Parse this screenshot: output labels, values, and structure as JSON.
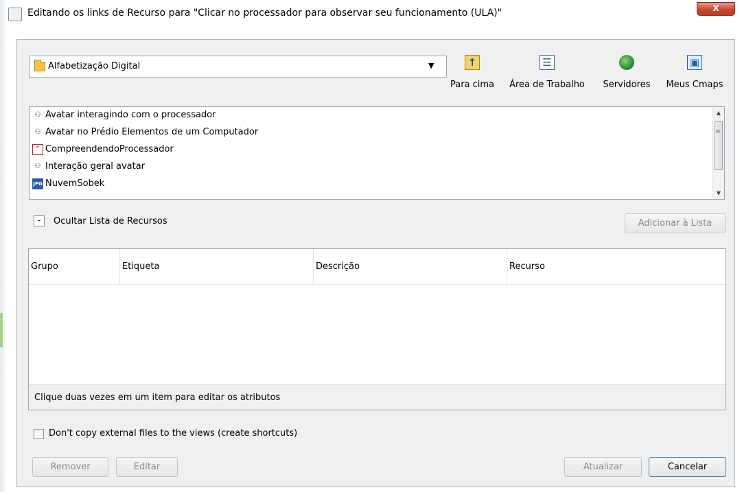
{
  "title": "Editando os links de Recurso para \"Clicar no processador para  observar seu funcionamento (ULA)\"",
  "close_label": "X",
  "location": {
    "value": "Alfabetização Digital"
  },
  "nav": [
    {
      "label": "Para cima",
      "icon": "folder-up-icon"
    },
    {
      "label": "Área de Trabalho",
      "icon": "desktop-icon"
    },
    {
      "label": "Servidores",
      "icon": "servers-globe-icon"
    },
    {
      "label": "Meus Cmaps",
      "icon": "my-cmaps-icon"
    }
  ],
  "resources": [
    {
      "label": "Avatar interagindo com o processador",
      "icon": "cmap-icon"
    },
    {
      "label": "Avatar no Prédio Elementos de um Computador",
      "icon": "cmap-icon"
    },
    {
      "label": "CompreendendoProcessador",
      "icon": "pdf-icon"
    },
    {
      "label": "Interação geral avatar",
      "icon": "cmap-icon"
    },
    {
      "label": "NuvemSobek",
      "icon": "jpg-icon"
    }
  ],
  "toggle": {
    "symbol": "-",
    "label": "Ocultar Lista de Recursos"
  },
  "add_button": "Adicionar à Lista",
  "table": {
    "columns": [
      "Grupo",
      "Etiqueta",
      "Descrição",
      "Recurso"
    ],
    "rows": [],
    "hint": "Clique duas vezes em um item para editar os atributos"
  },
  "checkbox": {
    "label": "Don't copy external files to the views (create shortcuts)",
    "checked": false
  },
  "buttons": {
    "remove": "Remover",
    "edit": "Editar",
    "update": "Atualizar",
    "cancel": "Cancelar"
  }
}
